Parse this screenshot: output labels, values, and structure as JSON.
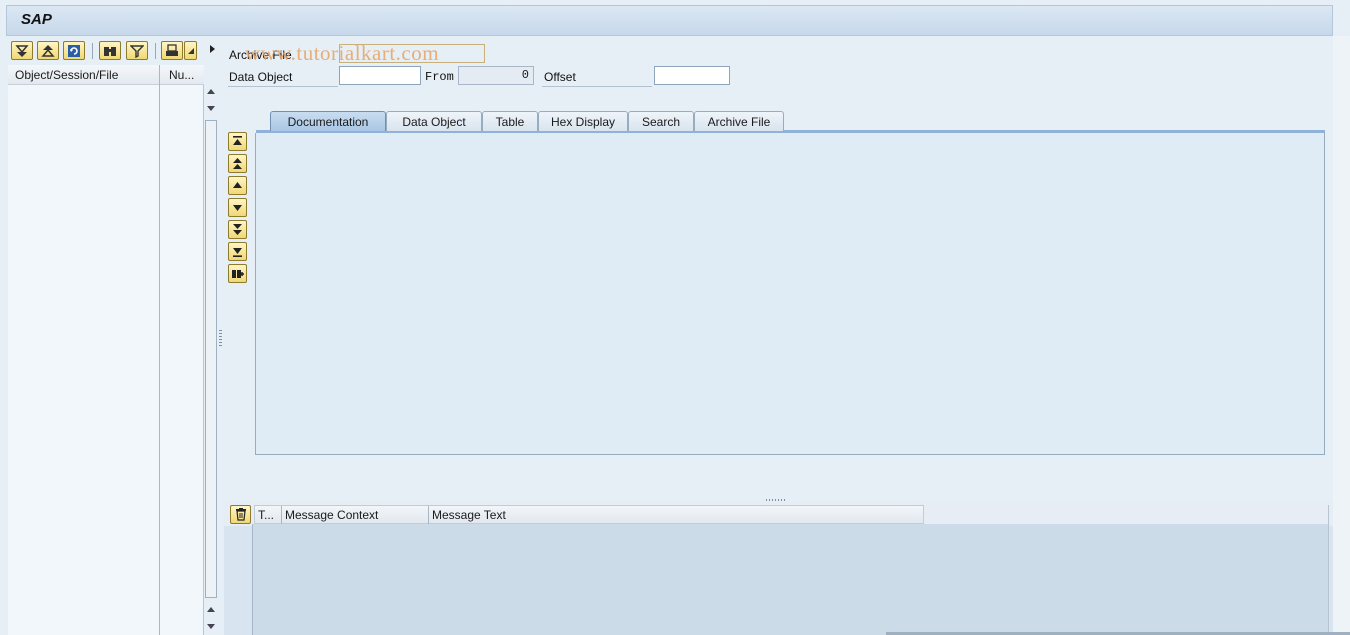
{
  "window": {
    "title": "SAP"
  },
  "watermark": "www.tutorialkart.com",
  "left_toolbar": {
    "buttons": [
      "expand-all-icon",
      "collapse-all-icon",
      "refresh-icon",
      "find-icon",
      "filter-icon",
      "print-icon"
    ]
  },
  "tree": {
    "columns": [
      "Object/Session/File",
      "Nu..."
    ]
  },
  "fields": {
    "archive_file_label": "Archive File",
    "data_object_label": "Data Object",
    "data_object_value": "",
    "from_label": "From",
    "from_value": "0",
    "offset_label": "Offset",
    "offset_value": ""
  },
  "nav_buttons": [
    "first-page-icon",
    "previous-page-fast-icon",
    "previous-page-icon",
    "next-page-icon",
    "next-page-fast-icon",
    "last-page-icon",
    "find-next-icon"
  ],
  "tabs": [
    {
      "label": "Documentation",
      "active": true
    },
    {
      "label": "Data Object",
      "active": false
    },
    {
      "label": "Table",
      "active": false
    },
    {
      "label": "Hex Display",
      "active": false
    },
    {
      "label": "Search",
      "active": false
    },
    {
      "label": "Archive File",
      "active": false
    }
  ],
  "messages": {
    "columns": [
      "T...",
      "Message Context",
      "Message Text"
    ]
  },
  "colors": {
    "toolbar_button": "#f0d875",
    "active_tab": "#a9c6e4",
    "panel": "#dfebf5"
  }
}
